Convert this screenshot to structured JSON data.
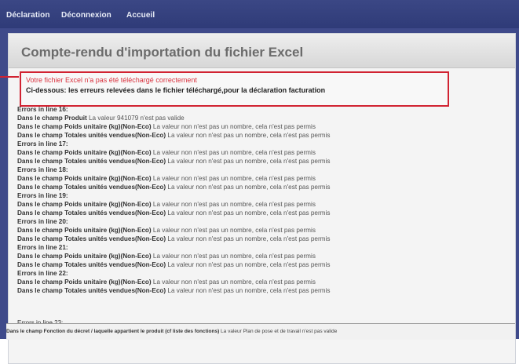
{
  "nav": {
    "items": [
      "Déclaration",
      "Déconnexion",
      "Accueil"
    ]
  },
  "page": {
    "title": "Compte-rendu d'importation du fichier Excel"
  },
  "alert": {
    "line1": "Votre fichier Excel n'a pas été téléchargé correctement",
    "line2": "Ci-dessous: les erreurs relevées dans le fichier téléchargé,pour la déclaration facturation"
  },
  "errors": [
    {
      "heading": "Errors in line 16:",
      "rows": [
        {
          "field": "Dans le champ Produit",
          "message": "La valeur 941079 n'est pas valide"
        },
        {
          "field": "Dans le champ Poids unitaire (kg)(Non-Eco)",
          "message": "La valeur non n'est pas un nombre, cela n'est pas permis"
        },
        {
          "field": "Dans le champ Totales unités vendues(Non-Eco)",
          "message": "La valeur non n'est pas un nombre, cela n'est pas permis"
        }
      ]
    },
    {
      "heading": "Errors in line 17:",
      "rows": [
        {
          "field": "Dans le champ Poids unitaire (kg)(Non-Eco)",
          "message": "La valeur non n'est pas un nombre, cela n'est pas permis"
        },
        {
          "field": "Dans le champ Totales unités vendues(Non-Eco)",
          "message": "La valeur non n'est pas un nombre, cela n'est pas permis"
        }
      ]
    },
    {
      "heading": "Errors in line 18:",
      "rows": [
        {
          "field": "Dans le champ Poids unitaire (kg)(Non-Eco)",
          "message": "La valeur non n'est pas un nombre, cela n'est pas permis"
        },
        {
          "field": "Dans le champ Totales unités vendues(Non-Eco)",
          "message": "La valeur non n'est pas un nombre, cela n'est pas permis"
        }
      ]
    },
    {
      "heading": "Errors in line 19:",
      "rows": [
        {
          "field": "Dans le champ Poids unitaire (kg)(Non-Eco)",
          "message": "La valeur non n'est pas un nombre, cela n'est pas permis"
        },
        {
          "field": "Dans le champ Totales unités vendues(Non-Eco)",
          "message": "La valeur non n'est pas un nombre, cela n'est pas permis"
        }
      ]
    },
    {
      "heading": "Errors in line 20:",
      "rows": [
        {
          "field": "Dans le champ Poids unitaire (kg)(Non-Eco)",
          "message": "La valeur non n'est pas un nombre, cela n'est pas permis"
        },
        {
          "field": "Dans le champ Totales unités vendues(Non-Eco)",
          "message": "La valeur non n'est pas un nombre, cela n'est pas permis"
        }
      ]
    },
    {
      "heading": "Errors in line 21:",
      "rows": [
        {
          "field": "Dans le champ Poids unitaire (kg)(Non-Eco)",
          "message": "La valeur non n'est pas un nombre, cela n'est pas permis"
        },
        {
          "field": "Dans le champ Totales unités vendues(Non-Eco)",
          "message": "La valeur non n'est pas un nombre, cela n'est pas permis"
        }
      ]
    },
    {
      "heading": "Errors in line 22:",
      "rows": [
        {
          "field": "Dans le champ Poids unitaire (kg)(Non-Eco)",
          "message": "La valeur non n'est pas un nombre, cela n'est pas permis"
        },
        {
          "field": "Dans le champ Totales unités vendues(Non-Eco)",
          "message": "La valeur non n'est pas un nombre, cela n'est pas permis"
        }
      ]
    }
  ],
  "partial_heading": "Errors in line 23:",
  "footer": {
    "field": "Dans le champ Fonction du décret / laquelle appartient le produit (cf liste des fonctions)",
    "message": "La valeur Plan de pose et de travail n'est pas valide"
  }
}
